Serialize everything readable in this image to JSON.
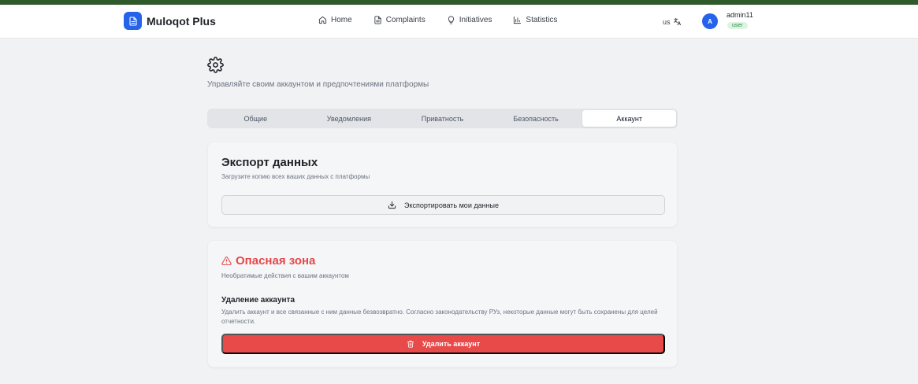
{
  "colors": {
    "accent_bar": "#2f5a2b",
    "brand": "#2563eb",
    "danger": "#e54848",
    "role_badge_bg": "#dcf5e3",
    "role_badge_text": "#2e8b4a"
  },
  "header": {
    "brand_name": "Muloqot Plus",
    "brand_icon": "document-icon",
    "nav": [
      {
        "label": "Home",
        "icon": "home-icon"
      },
      {
        "label": "Complaints",
        "icon": "document-icon"
      },
      {
        "label": "Initiatives",
        "icon": "lightbulb-icon"
      },
      {
        "label": "Statistics",
        "icon": "bar-chart-icon"
      }
    ],
    "language": "us",
    "language_icon": "translate-icon",
    "user": {
      "avatar_initial": "A",
      "name": "admin11",
      "role": "user"
    }
  },
  "page": {
    "settings_icon": "gear-icon",
    "subtitle": "Управляйте своим аккаунтом и предпочтениями платформы"
  },
  "tabs": [
    {
      "label": "Общие",
      "active": false
    },
    {
      "label": "Уведомления",
      "active": false
    },
    {
      "label": "Приватность",
      "active": false
    },
    {
      "label": "Безопасность",
      "active": false
    },
    {
      "label": "Аккаунт",
      "active": true
    }
  ],
  "export_card": {
    "title": "Экспорт данных",
    "description": "Загрузите копию всех ваших данных с платформы",
    "button_label": "Экспортировать мои данные",
    "button_icon": "download-icon"
  },
  "danger_card": {
    "title": "Опасная зона",
    "title_icon": "warning-icon",
    "description": "Необратимые действия с вашим аккаунтом",
    "delete_heading": "Удаление аккаунта",
    "delete_text": "Удалить аккаунт и все связанные с ним данные безвозвратно. Согласно законодательству РУз, некоторые данные могут быть сохранены для целей отчетности.",
    "button_label": "Удалить аккаунт",
    "button_icon": "trash-icon"
  }
}
